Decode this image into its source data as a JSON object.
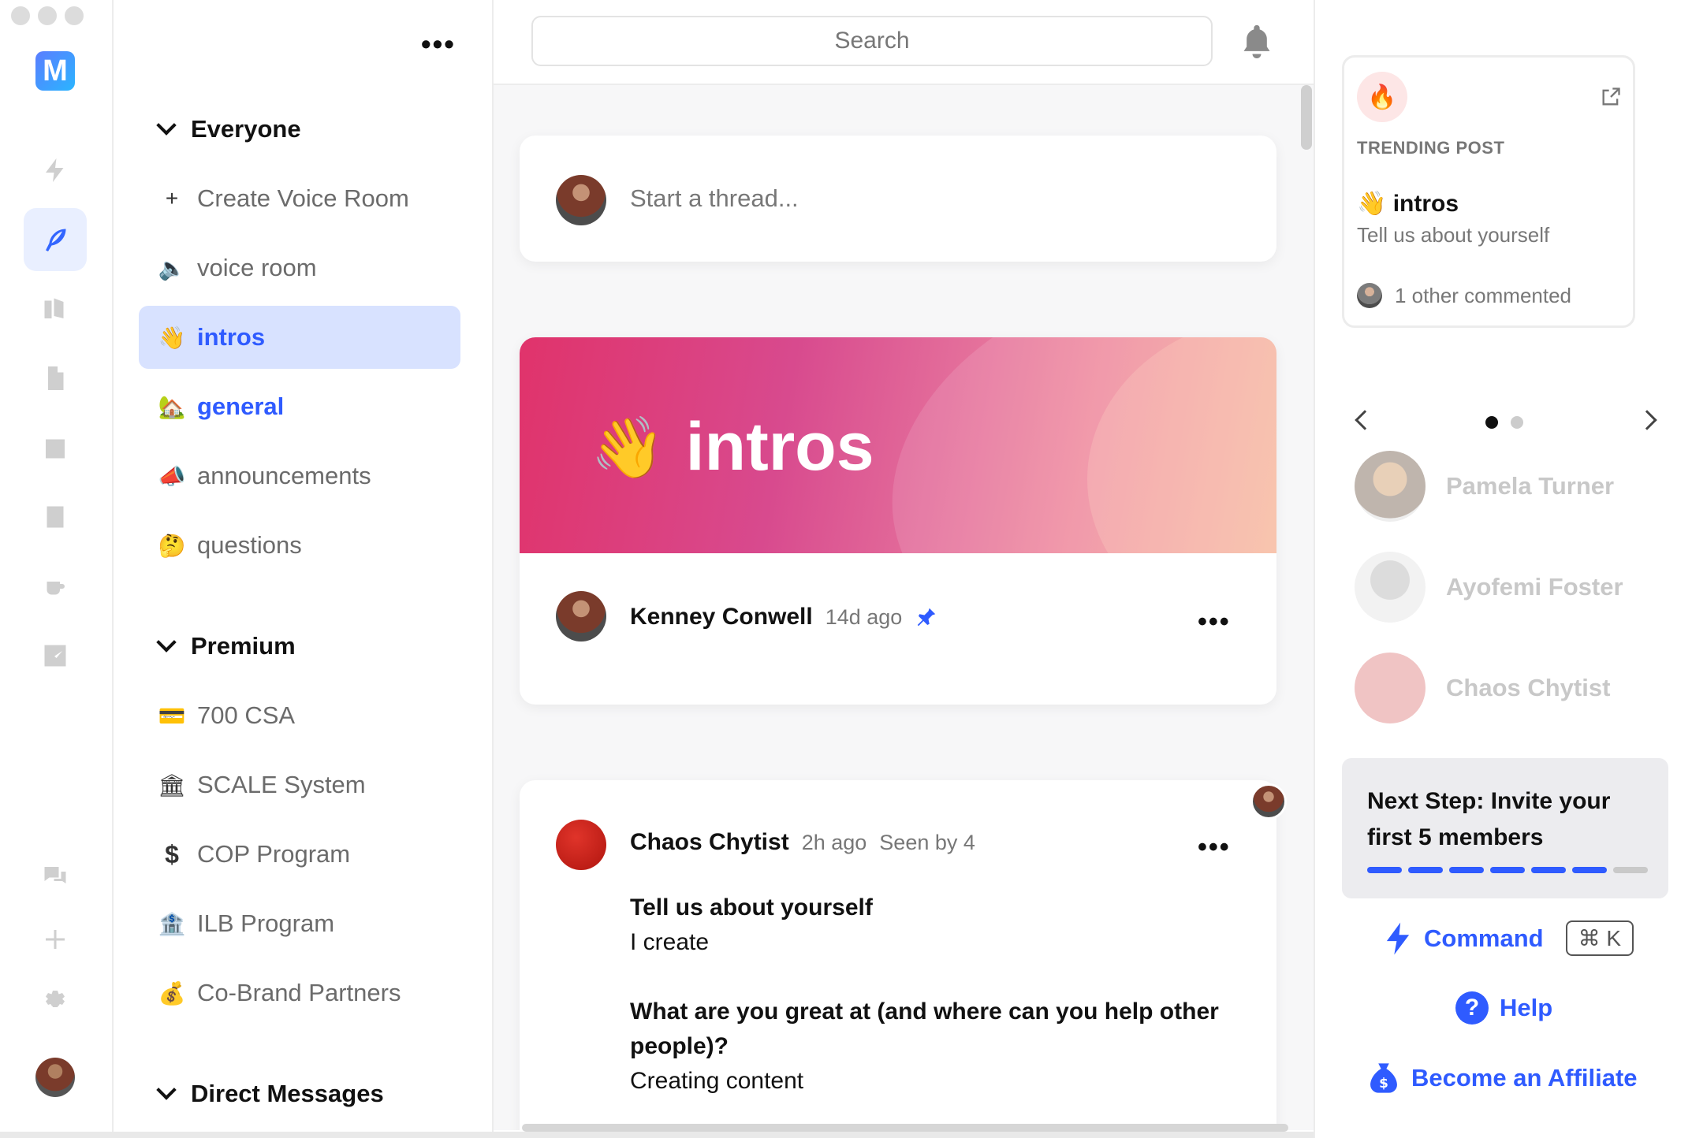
{
  "app": {
    "logo_letter": "M"
  },
  "sidebar": {
    "more_label": "•••",
    "sections": [
      {
        "title": "Everyone"
      },
      {
        "title": "Premium"
      },
      {
        "title": "Direct Messages"
      }
    ],
    "everyone_items": [
      {
        "icon": "+",
        "label": "Create Voice Room"
      },
      {
        "icon": "🔈",
        "label": "voice room"
      },
      {
        "icon": "👋",
        "label": "intros"
      },
      {
        "icon": "🏡",
        "label": "general"
      },
      {
        "icon": "📣",
        "label": "announcements"
      },
      {
        "icon": "🤔",
        "label": "questions"
      }
    ],
    "premium_items": [
      {
        "icon": "💳",
        "label": "700 CSA"
      },
      {
        "icon": "🏛",
        "label": "SCALE System"
      },
      {
        "icon": "$",
        "label": "COP Program"
      },
      {
        "icon": "🏦",
        "label": "ILB Program"
      },
      {
        "icon": "💰",
        "label": "Co-Brand Partners"
      }
    ]
  },
  "search": {
    "placeholder": "Search"
  },
  "feed": {
    "thread_placeholder": "Start a thread...",
    "banner": {
      "emoji": "👋",
      "title": "intros"
    },
    "pinned_post": {
      "author": "Kenney Conwell",
      "time": "14d ago",
      "more": "•••"
    },
    "post": {
      "author": "Chaos Chytist",
      "time": "2h ago",
      "seen": "Seen by 4",
      "more": "•••",
      "q1": "Tell us about yourself",
      "a1": "I create",
      "q2": "What are you great at (and where can you help other people)?",
      "a2": "Creating content"
    }
  },
  "right": {
    "trending": {
      "label": "TRENDING POST",
      "emoji": "👋",
      "title": "intros",
      "subtitle": "Tell us about yourself",
      "footer": "1 other commented"
    },
    "members": [
      {
        "name": "Pamela Turner"
      },
      {
        "name": "Ayofemi Foster"
      },
      {
        "name": "Chaos Chytist"
      }
    ],
    "next_step": {
      "title": "Next Step: Invite your first 5 members",
      "progress_done": 6,
      "progress_total": 7
    },
    "command": {
      "label": "Command",
      "shortcut": "⌘ K"
    },
    "help": {
      "label": "Help"
    },
    "affiliate": {
      "label": "Become an Affiliate"
    }
  },
  "colors": {
    "accent": "#2f5bff",
    "active_bg": "#d8e2ff"
  }
}
